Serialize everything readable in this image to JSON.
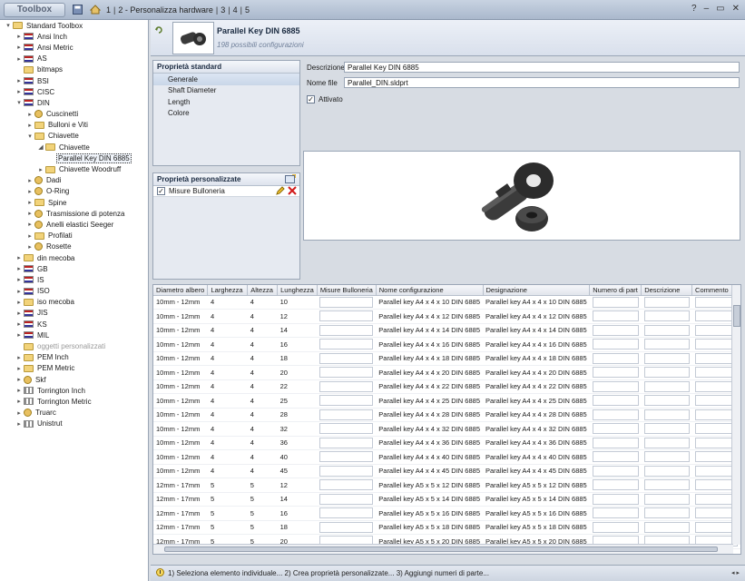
{
  "titlebar": {
    "app_name": "Toolbox",
    "breadcrumb": [
      "1",
      "2 - Personalizza hardware",
      "3",
      "4",
      "5"
    ],
    "controls": [
      "?",
      "–",
      "▭",
      "✕"
    ]
  },
  "tree": {
    "items": [
      {
        "label": "Standard Toolbox",
        "indent": 0,
        "exp": "▾",
        "icon": "folder"
      },
      {
        "label": "Ansi Inch",
        "indent": 1,
        "exp": "▸",
        "icon": "flag"
      },
      {
        "label": "Ansi Metric",
        "indent": 1,
        "exp": "▸",
        "icon": "flag"
      },
      {
        "label": "AS",
        "indent": 1,
        "exp": "▸",
        "icon": "flag"
      },
      {
        "label": "bitmaps",
        "indent": 1,
        "exp": "",
        "icon": "folder"
      },
      {
        "label": "BSI",
        "indent": 1,
        "exp": "▸",
        "icon": "flag"
      },
      {
        "label": "CISC",
        "indent": 1,
        "exp": "▸",
        "icon": "flag"
      },
      {
        "label": "DIN",
        "indent": 1,
        "exp": "▾",
        "icon": "flag"
      },
      {
        "label": "Cuscinetti",
        "indent": 2,
        "exp": "▸",
        "icon": "gear"
      },
      {
        "label": "Bulloni e Viti",
        "indent": 2,
        "exp": "▸",
        "icon": "folder"
      },
      {
        "label": "Chiavette",
        "indent": 2,
        "exp": "▾",
        "icon": "folder"
      },
      {
        "label": "Chiavette",
        "indent": 3,
        "exp": "◢",
        "icon": "folder"
      },
      {
        "label": "Parallel Key DIN 6885",
        "indent": 4,
        "exp": "",
        "icon": "none",
        "selected": true
      },
      {
        "label": "Chiavette Woodruff",
        "indent": 3,
        "exp": "▸",
        "icon": "folder"
      },
      {
        "label": "Dadi",
        "indent": 2,
        "exp": "▸",
        "icon": "gear"
      },
      {
        "label": "O-Ring",
        "indent": 2,
        "exp": "▸",
        "icon": "gear"
      },
      {
        "label": "Spine",
        "indent": 2,
        "exp": "▸",
        "icon": "folder"
      },
      {
        "label": "Trasmissione di potenza",
        "indent": 2,
        "exp": "▸",
        "icon": "gear"
      },
      {
        "label": "Anelli elastici Seeger",
        "indent": 2,
        "exp": "▸",
        "icon": "gear"
      },
      {
        "label": "Profilati",
        "indent": 2,
        "exp": "▸",
        "icon": "folder"
      },
      {
        "label": "Rosette",
        "indent": 2,
        "exp": "▸",
        "icon": "gear"
      },
      {
        "label": "din mecoba",
        "indent": 1,
        "exp": "▸",
        "icon": "folder"
      },
      {
        "label": "GB",
        "indent": 1,
        "exp": "▸",
        "icon": "flag"
      },
      {
        "label": "IS",
        "indent": 1,
        "exp": "▸",
        "icon": "flag"
      },
      {
        "label": "ISO",
        "indent": 1,
        "exp": "▸",
        "icon": "flag"
      },
      {
        "label": "iso mecoba",
        "indent": 1,
        "exp": "▸",
        "icon": "folder"
      },
      {
        "label": "JIS",
        "indent": 1,
        "exp": "▸",
        "icon": "flag"
      },
      {
        "label": "KS",
        "indent": 1,
        "exp": "▸",
        "icon": "flag"
      },
      {
        "label": "MIL",
        "indent": 1,
        "exp": "▸",
        "icon": "flag"
      },
      {
        "label": "oggetti personalizzati",
        "indent": 1,
        "exp": "",
        "icon": "folder",
        "grey": true
      },
      {
        "label": "PEM Inch",
        "indent": 1,
        "exp": "▸",
        "icon": "folder"
      },
      {
        "label": "PEM Metric",
        "indent": 1,
        "exp": "▸",
        "icon": "folder"
      },
      {
        "label": "Skf",
        "indent": 1,
        "exp": "▸",
        "icon": "gear"
      },
      {
        "label": "Torrington Inch",
        "indent": 1,
        "exp": "▸",
        "icon": "dots"
      },
      {
        "label": "Torrington Metric",
        "indent": 1,
        "exp": "▸",
        "icon": "dots"
      },
      {
        "label": "Truarc",
        "indent": 1,
        "exp": "▸",
        "icon": "gear"
      },
      {
        "label": "Unistrut",
        "indent": 1,
        "exp": "▸",
        "icon": "dots"
      }
    ]
  },
  "header": {
    "title": "Parallel Key DIN 6885",
    "subtitle": "198 possibili configurazioni"
  },
  "standard_props": {
    "heading": "Proprietà standard",
    "items": [
      "Generale",
      "Shaft Diameter",
      "Length",
      "Colore"
    ],
    "selected_index": 0
  },
  "custom_props": {
    "heading": "Proprietà personalizzate",
    "items": [
      {
        "label": "Misure Bulloneria",
        "checked": true
      }
    ]
  },
  "fields": {
    "description_label": "Descrizione",
    "description_value": "Parallel Key DIN 6885",
    "filename_label": "Nome file",
    "filename_value": "Parallel_DIN.sldprt",
    "enabled_label": "Attivato",
    "enabled_checked": true
  },
  "table": {
    "columns": [
      "Diametro albero",
      "Larghezza",
      "Altezza",
      "Lunghezza",
      "Misure Bulloneria",
      "Nome configurazione",
      "Designazione",
      "Numero di part",
      "Descrizione",
      "Commento"
    ],
    "rows": [
      [
        "10mm - 12mm",
        "4",
        "4",
        "10",
        "",
        "Parallel key A4 x 4 x 10 DIN 6885",
        "Parallel key A4 x 4 x 10 DIN 6885",
        "",
        "",
        ""
      ],
      [
        "10mm - 12mm",
        "4",
        "4",
        "12",
        "",
        "Parallel key A4 x 4 x 12 DIN 6885",
        "Parallel key A4 x 4 x 12 DIN 6885",
        "",
        "",
        ""
      ],
      [
        "10mm - 12mm",
        "4",
        "4",
        "14",
        "",
        "Parallel key A4 x 4 x 14 DIN 6885",
        "Parallel key A4 x 4 x 14 DIN 6885",
        "",
        "",
        ""
      ],
      [
        "10mm - 12mm",
        "4",
        "4",
        "16",
        "",
        "Parallel key A4 x 4 x 16 DIN 6885",
        "Parallel key A4 x 4 x 16 DIN 6885",
        "",
        "",
        ""
      ],
      [
        "10mm - 12mm",
        "4",
        "4",
        "18",
        "",
        "Parallel key A4 x 4 x 18 DIN 6885",
        "Parallel key A4 x 4 x 18 DIN 6885",
        "",
        "",
        ""
      ],
      [
        "10mm - 12mm",
        "4",
        "4",
        "20",
        "",
        "Parallel key A4 x 4 x 20 DIN 6885",
        "Parallel key A4 x 4 x 20 DIN 6885",
        "",
        "",
        ""
      ],
      [
        "10mm - 12mm",
        "4",
        "4",
        "22",
        "",
        "Parallel key A4 x 4 x 22 DIN 6885",
        "Parallel key A4 x 4 x 22 DIN 6885",
        "",
        "",
        ""
      ],
      [
        "10mm - 12mm",
        "4",
        "4",
        "25",
        "",
        "Parallel key A4 x 4 x 25 DIN 6885",
        "Parallel key A4 x 4 x 25 DIN 6885",
        "",
        "",
        ""
      ],
      [
        "10mm - 12mm",
        "4",
        "4",
        "28",
        "",
        "Parallel key A4 x 4 x 28 DIN 6885",
        "Parallel key A4 x 4 x 28 DIN 6885",
        "",
        "",
        ""
      ],
      [
        "10mm - 12mm",
        "4",
        "4",
        "32",
        "",
        "Parallel key A4 x 4 x 32 DIN 6885",
        "Parallel key A4 x 4 x 32 DIN 6885",
        "",
        "",
        ""
      ],
      [
        "10mm - 12mm",
        "4",
        "4",
        "36",
        "",
        "Parallel key A4 x 4 x 36 DIN 6885",
        "Parallel key A4 x 4 x 36 DIN 6885",
        "",
        "",
        ""
      ],
      [
        "10mm - 12mm",
        "4",
        "4",
        "40",
        "",
        "Parallel key A4 x 4 x 40 DIN 6885",
        "Parallel key A4 x 4 x 40 DIN 6885",
        "",
        "",
        ""
      ],
      [
        "10mm - 12mm",
        "4",
        "4",
        "45",
        "",
        "Parallel key A4 x 4 x 45 DIN 6885",
        "Parallel key A4 x 4 x 45 DIN 6885",
        "",
        "",
        ""
      ],
      [
        "12mm - 17mm",
        "5",
        "5",
        "12",
        "",
        "Parallel key A5 x 5 x 12 DIN 6885",
        "Parallel key A5 x 5 x 12 DIN 6885",
        "",
        "",
        ""
      ],
      [
        "12mm - 17mm",
        "5",
        "5",
        "14",
        "",
        "Parallel key A5 x 5 x 14 DIN 6885",
        "Parallel key A5 x 5 x 14 DIN 6885",
        "",
        "",
        ""
      ],
      [
        "12mm - 17mm",
        "5",
        "5",
        "16",
        "",
        "Parallel key A5 x 5 x 16 DIN 6885",
        "Parallel key A5 x 5 x 16 DIN 6885",
        "",
        "",
        ""
      ],
      [
        "12mm - 17mm",
        "5",
        "5",
        "18",
        "",
        "Parallel key A5 x 5 x 18 DIN 6885",
        "Parallel key A5 x 5 x 18 DIN 6885",
        "",
        "",
        ""
      ],
      [
        "12mm - 17mm",
        "5",
        "5",
        "20",
        "",
        "Parallel key A5 x 5 x 20 DIN 6885",
        "Parallel key A5 x 5 x 20 DIN 6885",
        "",
        "",
        ""
      ]
    ]
  },
  "statusbar": {
    "text": "1) Seleziona elemento individuale... 2) Crea proprietà personalizzate... 3) Aggiungi numeri di parte..."
  }
}
